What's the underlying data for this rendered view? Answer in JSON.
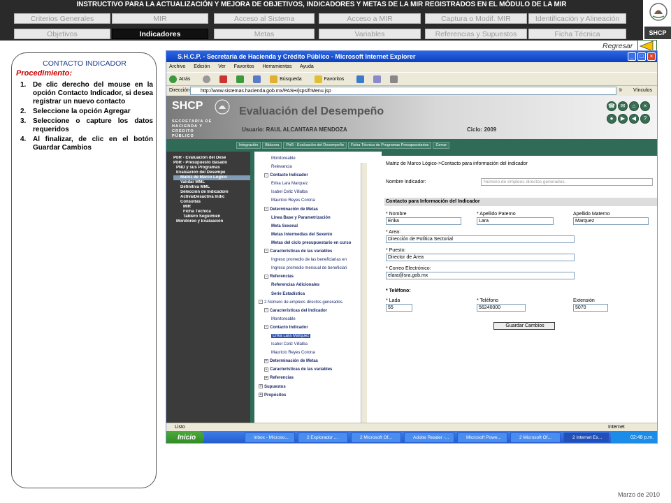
{
  "header": {
    "title": "INSTRUCTIVO PARA  LA ACTUALIZACIÓN Y MEJORA DE OBJETIVOS, INDICADORES Y METAS DE LA MIR REGISTRADOS EN EL MÓDULO DE LA MIR",
    "nav_row1": [
      "Criterios Generales",
      "MIR",
      "Acceso al Sistema",
      "Acceso a MIR",
      "Captura o Modif. MIR",
      "Identificación y Alineación"
    ],
    "nav_row2": [
      "Objetivos",
      "Indicadores",
      "Metas",
      "Variables",
      "Referencias y Supuestos",
      "Ficha Técnica"
    ],
    "active_tab": "Indicadores",
    "brand": "SHCP"
  },
  "left_panel": {
    "heading": "CONTACTO INDICADOR",
    "procedure_label": "Procedimiento:",
    "steps": [
      {
        "num": "1.",
        "text": "De clic derecho del mouse en la opción Contacto Indicador, si desea registrar un nuevo contacto"
      },
      {
        "num": "2.",
        "text": "Seleccione la opción Agregar"
      },
      {
        "num": "3.",
        "text": "Seleccione o capture los datos requeridos"
      },
      {
        "num": "4.",
        "text": "Al finalizar, de clic en el botón Guardar Cambios"
      }
    ]
  },
  "regresar": "Regresar",
  "footer_date": "Marzo de 2010",
  "screenshot": {
    "window_title": "S.H.C.P. - Secretaría de Hacienda y Crédito Público - Microsoft Internet Explorer",
    "menu": [
      "Archivo",
      "Edición",
      "Ver",
      "Favoritos",
      "Herramientas",
      "Ayuda"
    ],
    "toolbar": [
      "Atrás",
      "Búsqueda",
      "Favoritos"
    ],
    "address_label": "Dirección",
    "address_url": "http://www.sistemas.hacienda.gob.mx/PASH/jsps/frMenu.jsp",
    "address_go": "Ir",
    "address_links": "Vínculos",
    "site": {
      "logo": "SHCP",
      "secretaria": "SECRETARÍA DE HACIENDA Y CRÉDITO PÚBLICO",
      "eval_title": "Evaluación del Desempeño",
      "user": "Usuario: RAUL ALCANTARA MENDOZA",
      "ciclo": "Ciclo: 2009",
      "tabs": [
        "Integración",
        "Bitácora",
        "PbR - Evaluación del Desempeño",
        "Ficha Técnica de Programas Presupuestarios",
        "Cerrar"
      ]
    },
    "leftnav": [
      {
        "text": "PbR - Evaluación del Dese",
        "level": 0
      },
      {
        "text": "PbR - Presupuesto Basado",
        "level": 0
      },
      {
        "text": "PND y sus Programas",
        "level": 1
      },
      {
        "text": "Evaluación del Desempe",
        "level": 1
      },
      {
        "text": "Matriz de Marco Lógico",
        "level": 2,
        "hl": true
      },
      {
        "text": "Validar MML",
        "level": 2
      },
      {
        "text": "Definitiva MML",
        "level": 2
      },
      {
        "text": "Selección de Indicadore",
        "level": 2
      },
      {
        "text": "Activa/Desactiva Indic",
        "level": 2
      },
      {
        "text": "Consultas",
        "level": 2
      },
      {
        "text": "MIR",
        "level": 3
      },
      {
        "text": "Ficha Técnica",
        "level": 3
      },
      {
        "text": "Tablero Seguimien",
        "level": 3
      },
      {
        "text": "Monitoreo y Evaluación",
        "level": 1
      }
    ],
    "tree": [
      {
        "text": "Monitoreable",
        "level": 2
      },
      {
        "text": "Relevancia",
        "level": 2
      },
      {
        "text": "Contacto Indicador",
        "level": 1,
        "bold": true,
        "pm": "-"
      },
      {
        "text": "Erika Lara Marquez",
        "level": 2
      },
      {
        "text": "Isabel Celiz Villalba",
        "level": 2
      },
      {
        "text": "Mauricio Reyes Corona",
        "level": 2
      },
      {
        "text": "Determinación de Metas",
        "level": 1,
        "bold": true,
        "pm": "-"
      },
      {
        "text": "Línea Base y Parametrización",
        "level": 2,
        "bold": true
      },
      {
        "text": "Meta Sexenal",
        "level": 2,
        "bold": true
      },
      {
        "text": "Metas Intermedias del Sexenio",
        "level": 2,
        "bold": true
      },
      {
        "text": "Metas del ciclo presupuestario en curso",
        "level": 2,
        "bold": true
      },
      {
        "text": "Características de las variables",
        "level": 1,
        "bold": true,
        "pm": "-"
      },
      {
        "text": "Ingreso promedio de las beneficiarias en",
        "level": 2
      },
      {
        "text": "Ingreso promedio mensual de beneficiari",
        "level": 2
      },
      {
        "text": "Referencias",
        "level": 1,
        "bold": true,
        "pm": "-"
      },
      {
        "text": "Referencias Adicionales",
        "level": 2,
        "bold": true
      },
      {
        "text": "Serie Estadística",
        "level": 2,
        "bold": true
      },
      {
        "text": "2 Número de empleos directos generados.",
        "level": 0,
        "pm": "-"
      },
      {
        "text": "Características del Indicador",
        "level": 1,
        "bold": true,
        "pm": "-"
      },
      {
        "text": "Monitoreable",
        "level": 2
      },
      {
        "text": "Contacto Indicador",
        "level": 1,
        "bold": true,
        "pm": "-"
      },
      {
        "text": "Erika Lara Marquez",
        "level": 2,
        "selected": true
      },
      {
        "text": "Isabel Celiz Villalba",
        "level": 2
      },
      {
        "text": "Mauricio Reyes Corona",
        "level": 2
      },
      {
        "text": "Determinación de Metas",
        "level": 1,
        "bold": true,
        "pm": "+"
      },
      {
        "text": "Características de las variables",
        "level": 1,
        "bold": true,
        "pm": "+"
      },
      {
        "text": "Referencias",
        "level": 1,
        "bold": true,
        "pm": "+"
      },
      {
        "text": "Supuestos",
        "level": 0,
        "bold": true,
        "pm": "+"
      },
      {
        "text": "Propósitos",
        "level": 0,
        "bold": true,
        "pm": "+"
      }
    ],
    "form": {
      "breadcrumb": "Matriz de Marco Lógico->Contacto para información del indicador",
      "nombre_label": "Nombre Indicador:",
      "nombre_value": "Número de empleos directos generados.",
      "section": "Contacto para Información del Indicador",
      "nombre_field_label": "* Nombre",
      "nombre_field_value": "Erika",
      "ap_paterno_label": "* Apellido Paterno",
      "ap_paterno_value": "Lara",
      "ap_materno_label": "Apellido Materno",
      "ap_materno_value": "Marquez",
      "area_label": "* Area:",
      "area_value": "Dirección de Política Sectorial",
      "puesto_label": "* Puesto:",
      "puesto_value": "Director de Área",
      "correo_label": "* Correo Electrónico:",
      "correo_value": "elara@sra.gob.mx",
      "telefono_section": "* Teléfono:",
      "lada_label": "* Lada",
      "lada_value": "55",
      "telefono_label": "* Teléfono",
      "telefono_value": "56240000",
      "extension_label": "Extensión",
      "extension_value": "5070",
      "save_label": "Guardar Cambios"
    },
    "status": "Listo",
    "status_zone": "Internet",
    "taskbar": {
      "start": "Inicio",
      "items": [
        "Inbox - Microso...",
        "2 Explorador ...",
        "2 Microsoft Of...",
        "Adobe Reader -...",
        "Microsoft Powe...",
        "2 Microsoft Of...",
        "2 Internet Ex..."
      ],
      "clock": "02:48 p.m."
    }
  }
}
